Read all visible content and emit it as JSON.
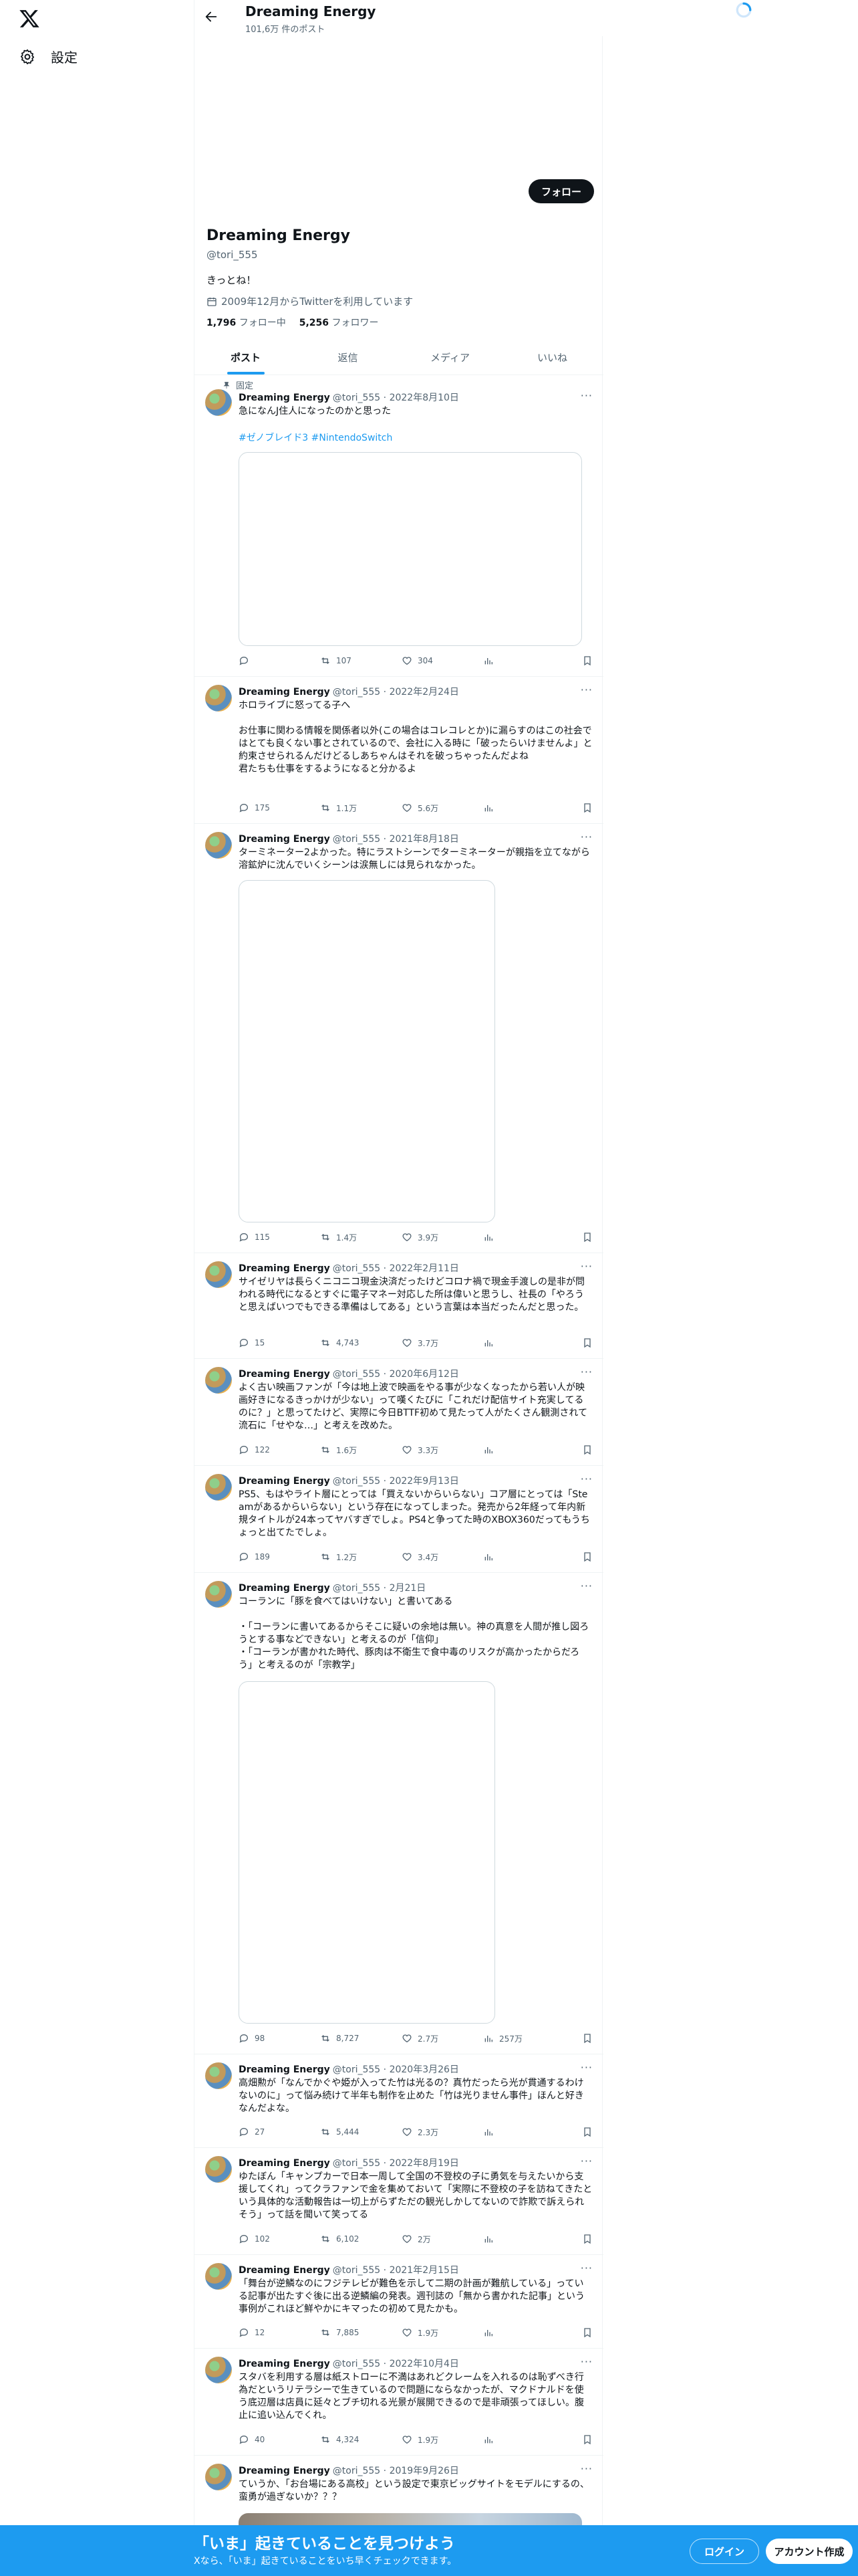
{
  "nav": {
    "settings_label": "設定"
  },
  "header": {
    "name": "Dreaming Energy",
    "post_count": "101,6万 件のポスト"
  },
  "profile": {
    "follow_button": "フォロー",
    "name": "Dreaming Energy",
    "handle": "@tori_555",
    "bio": "きっとね！",
    "joined": "2009年12月からTwitterを利用しています",
    "following_count": "1,796",
    "following_label": "フォロー中",
    "followers_count": "5,256",
    "followers_label": "フォロワー"
  },
  "tabs": [
    "ポスト",
    "返信",
    "メディア",
    "いいね"
  ],
  "pinned_label": "固定",
  "tweets": [
    {
      "name": "Dreaming Energy",
      "handle": "@tori_555",
      "date": "2022年8月10日",
      "text": "急になんJ住人になったのかと思った",
      "tags": "#ゼノブレイド3 #NintendoSwitch",
      "replies": "",
      "reposts": "107",
      "likes": "304",
      "views": ""
    },
    {
      "name": "Dreaming Energy",
      "handle": "@tori_555",
      "date": "2022年2月24日",
      "text": "ホロライブに怒ってる子へ\n\nお仕事に関わる情報を関係者以外(この場合はコレコレとか)に漏らすのはこの社会ではとても良くない事とされているので、会社に入る時に「破ったらいけませんよ」と約束させられるんだけどるしあちゃんはそれを破っちゃったんだよね\n君たちも仕事をするようになると分かるよ",
      "replies": "175",
      "reposts": "1.1万",
      "likes": "5.6万",
      "views": ""
    },
    {
      "name": "Dreaming Energy",
      "handle": "@tori_555",
      "date": "2021年8月18日",
      "text": "ターミネーター2よかった。特にラストシーンでターミネーターが親指を立てながら溶鉱炉に沈んでいくシーンは涙無しには見られなかった。",
      "replies": "115",
      "reposts": "1.4万",
      "likes": "3.9万",
      "views": ""
    },
    {
      "name": "Dreaming Energy",
      "handle": "@tori_555",
      "date": "2022年2月11日",
      "text": "サイゼリヤは長らくニコニコ現金決済だったけどコロナ禍で現金手渡しの是非が問われる時代になるとすぐに電子マネー対応した所は偉いと思うし、社長の「やろうと思えばいつでもできる準備はしてある」という言葉は本当だったんだと思った。",
      "replies": "15",
      "reposts": "4,743",
      "likes": "3.7万",
      "views": ""
    },
    {
      "name": "Dreaming Energy",
      "handle": "@tori_555",
      "date": "2020年6月12日",
      "text": "よく古い映画ファンが「今は地上波で映画をやる事が少なくなったから若い人が映画好きになるきっかけが少ない」って嘆くたびに「これだけ配信サイト充実してるのに？」と思ってたけど、実際に今日BTTF初めて見たって人がたくさん観測されて流石に「せやな…」と考えを改めた。",
      "replies": "122",
      "reposts": "1.6万",
      "likes": "3.3万",
      "views": ""
    },
    {
      "name": "Dreaming Energy",
      "handle": "@tori_555",
      "date": "2022年9月13日",
      "text": "PS5、もはやライト層にとっては「買えないからいらない」コア層にとっては「Steamがあるからいらない」という存在になってしまった。発売から2年経って年内新規タイトルが24本ってヤバすぎでしょ。PS4と争ってた時のXBOX360だってもうちょっと出てたでしょ。",
      "replies": "189",
      "reposts": "1.2万",
      "likes": "3.4万",
      "views": ""
    },
    {
      "name": "Dreaming Energy",
      "handle": "@tori_555",
      "date": "2月21日",
      "text": "コーランに「豚を食べてはいけない」と書いてある\n\n・「コーランに書いてあるからそこに疑いの余地は無い。神の真意を人間が推し図ろうとする事などできない」と考えるのが「信仰」\n・「コーランが書かれた時代、豚肉は不衛生で食中毒のリスクが高かったからだろう」と考えるのが「宗教学」",
      "replies": "98",
      "reposts": "8,727",
      "likes": "2.7万",
      "views": "257万"
    },
    {
      "name": "Dreaming Energy",
      "handle": "@tori_555",
      "date": "2020年3月26日",
      "text": "高畑勲が「なんでかぐや姫が入ってた竹は光るの？真竹だったら光が貫通するわけないのに」って悩み続けて半年も制作を止めた「竹は光りません事件」ほんと好きなんだよな。",
      "replies": "27",
      "reposts": "5,444",
      "likes": "2.3万",
      "views": ""
    },
    {
      "name": "Dreaming Energy",
      "handle": "@tori_555",
      "date": "2022年8月19日",
      "text": "ゆたぼん「キャンプカーで日本一周して全国の不登校の子に勇気を与えたいから支援してくれ」ってクラファンで金を集めておいて「実際に不登校の子を訪ねてきたという具体的な活動報告は一切上がらずただの観光しかしてないので詐欺で訴えられそう」って話を聞いて笑ってる",
      "replies": "102",
      "reposts": "6,102",
      "likes": "2万",
      "views": ""
    },
    {
      "name": "Dreaming Energy",
      "handle": "@tori_555",
      "date": "2021年2月15日",
      "text": "「舞台が逆鱗なのにフジテレビが難色を示して二期の計画が難航している」っている記事が出たすぐ後に出る逆鱗編の発表。週刊誌の「無から書かれた記事」という事例がこれほど鮮やかにキマったの初めて見たかも。",
      "replies": "12",
      "reposts": "7,885",
      "likes": "1.9万",
      "views": ""
    },
    {
      "name": "Dreaming Energy",
      "handle": "@tori_555",
      "date": "2022年10月4日",
      "text": "スタバを利用する層は紙ストローに不満はあれどクレームを入れるのは恥ずべき行為だというリテラシーで生きているので問題にならなかったが、マクドナルドを使う底辺層は店員に延々とブチ切れる光景が展開できるので是非頑張ってほしい。腹止に追い込んでくれ。",
      "replies": "40",
      "reposts": "4,324",
      "likes": "1.9万",
      "views": ""
    },
    {
      "name": "Dreaming Energy",
      "handle": "@tori_555",
      "date": "2019年9月26日",
      "text": "ていうか、「お台場にある高校」という設定で東京ビッグサイトをモデルにするの、蛮勇が過ぎないか？？？",
      "replies": "",
      "reposts": "",
      "likes": "",
      "views": ""
    }
  ],
  "banner": {
    "title": "「いま」起きていることを見つけよう",
    "subtitle": "Xなら、「いま」起きていることをいち早くチェックできます。",
    "login": "ログイン",
    "signup": "アカウント作成"
  }
}
